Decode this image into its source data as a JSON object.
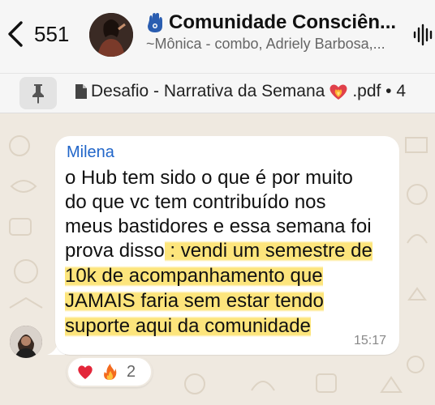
{
  "header": {
    "back_count": "551",
    "group_name": "Comunidade Consciên...",
    "members": "~Mônica - combo, Adriely Barbosa,..."
  },
  "pinned": {
    "text_before": "Desafio - Narrativa da Semana",
    "text_after": ".pdf • 4"
  },
  "message": {
    "sender": "Milena",
    "lines": [
      {
        "plain": "o Hub tem sido o que é por muito",
        "highlight": ""
      },
      {
        "plain": "do que vc tem contribuído nos",
        "highlight": ""
      },
      {
        "plain": "meus bastidores e essa semana foi",
        "highlight": ""
      },
      {
        "plain": "prova disso",
        "highlight": " : vendi um semestre de"
      },
      {
        "plain": "",
        "highlight": "10k de acompanhamento que"
      },
      {
        "plain": "",
        "highlight": "JAMAIS faria sem estar tendo"
      },
      {
        "plain": "",
        "highlight": "suporte aqui da comunidade"
      }
    ],
    "time": "15:17"
  },
  "reactions": {
    "emojis": [
      "heart-icon",
      "fire-icon"
    ],
    "count": "2"
  },
  "colors": {
    "sender": "#2166c9",
    "highlight": "#fde57c",
    "wallpaper": "#efe9e0",
    "bubble": "#ffffff"
  }
}
